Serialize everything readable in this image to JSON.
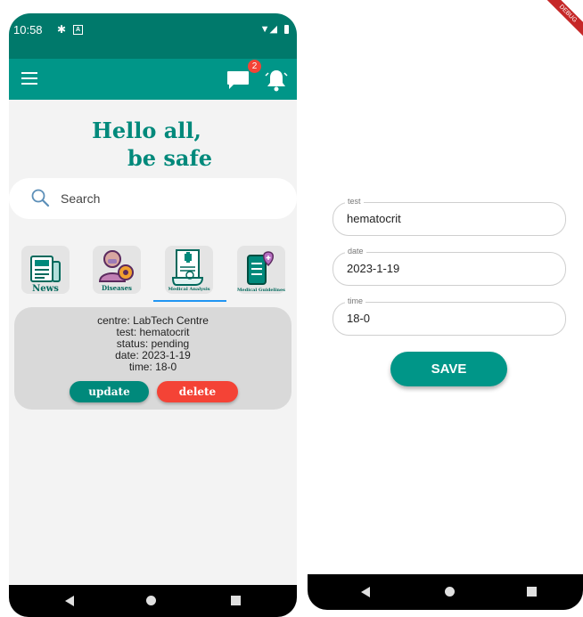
{
  "status_bar": {
    "time": "10:58"
  },
  "app_bar": {
    "chat_badge": "2"
  },
  "greeting": {
    "line1": "Hello all,",
    "line2": "be safe"
  },
  "search": {
    "placeholder": "Search"
  },
  "categories": [
    {
      "label": "News"
    },
    {
      "label": "Diseases"
    },
    {
      "label": "Medical Analysis"
    },
    {
      "label": "Medical Guidelines"
    }
  ],
  "analysis_card": {
    "centre": "centre: LabTech Centre",
    "test": "test: hematocrit",
    "status": "status: pending",
    "date": "date: 2023-1-19",
    "time": "time: 18-0",
    "update_label": "update",
    "delete_label": "delete"
  },
  "form": {
    "debug_label": "DEBUG",
    "fields": [
      {
        "label": "test",
        "value": "hematocrit"
      },
      {
        "label": "date",
        "value": "2023-1-19"
      },
      {
        "label": "time",
        "value": "18-0"
      }
    ],
    "save_label": "SAVE"
  },
  "colors": {
    "primary": "#009688",
    "dark_primary": "#00796b",
    "danger": "#f44336",
    "accent": "#2196f3"
  }
}
